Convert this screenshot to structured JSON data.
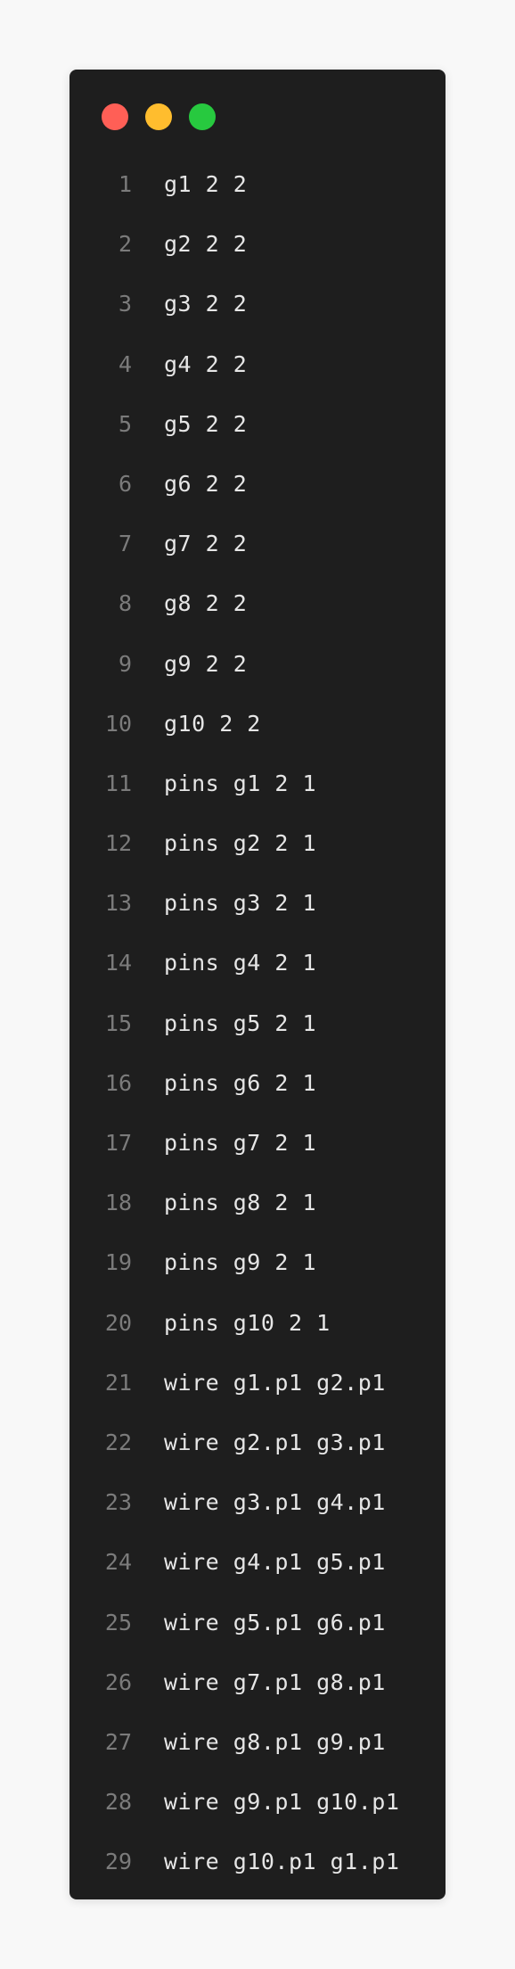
{
  "window": {
    "controls": [
      {
        "name": "close",
        "color": "#ff5f56"
      },
      {
        "name": "minimize",
        "color": "#ffbd2e"
      },
      {
        "name": "maximize",
        "color": "#27c93f"
      }
    ]
  },
  "code": {
    "lines": [
      {
        "n": "1",
        "text": "g1 2 2"
      },
      {
        "n": "2",
        "text": "g2 2 2"
      },
      {
        "n": "3",
        "text": "g3 2 2"
      },
      {
        "n": "4",
        "text": "g4 2 2"
      },
      {
        "n": "5",
        "text": "g5 2 2"
      },
      {
        "n": "6",
        "text": "g6 2 2"
      },
      {
        "n": "7",
        "text": "g7 2 2"
      },
      {
        "n": "8",
        "text": "g8 2 2"
      },
      {
        "n": "9",
        "text": "g9 2 2"
      },
      {
        "n": "10",
        "text": "g10 2 2"
      },
      {
        "n": "11",
        "text": "pins g1 2 1"
      },
      {
        "n": "12",
        "text": "pins g2 2 1"
      },
      {
        "n": "13",
        "text": "pins g3 2 1"
      },
      {
        "n": "14",
        "text": "pins g4 2 1"
      },
      {
        "n": "15",
        "text": "pins g5 2 1"
      },
      {
        "n": "16",
        "text": "pins g6 2 1"
      },
      {
        "n": "17",
        "text": "pins g7 2 1"
      },
      {
        "n": "18",
        "text": "pins g8 2 1"
      },
      {
        "n": "19",
        "text": "pins g9 2 1"
      },
      {
        "n": "20",
        "text": "pins g10 2 1"
      },
      {
        "n": "21",
        "text": "wire g1.p1 g2.p1"
      },
      {
        "n": "22",
        "text": "wire g2.p1 g3.p1"
      },
      {
        "n": "23",
        "text": "wire g3.p1 g4.p1"
      },
      {
        "n": "24",
        "text": "wire g4.p1 g5.p1"
      },
      {
        "n": "25",
        "text": "wire g5.p1 g6.p1"
      },
      {
        "n": "26",
        "text": "wire g7.p1 g8.p1"
      },
      {
        "n": "27",
        "text": "wire g8.p1 g9.p1"
      },
      {
        "n": "28",
        "text": "wire g9.p1 g10.p1"
      },
      {
        "n": "29",
        "text": "wire g10.p1 g1.p1"
      }
    ]
  }
}
